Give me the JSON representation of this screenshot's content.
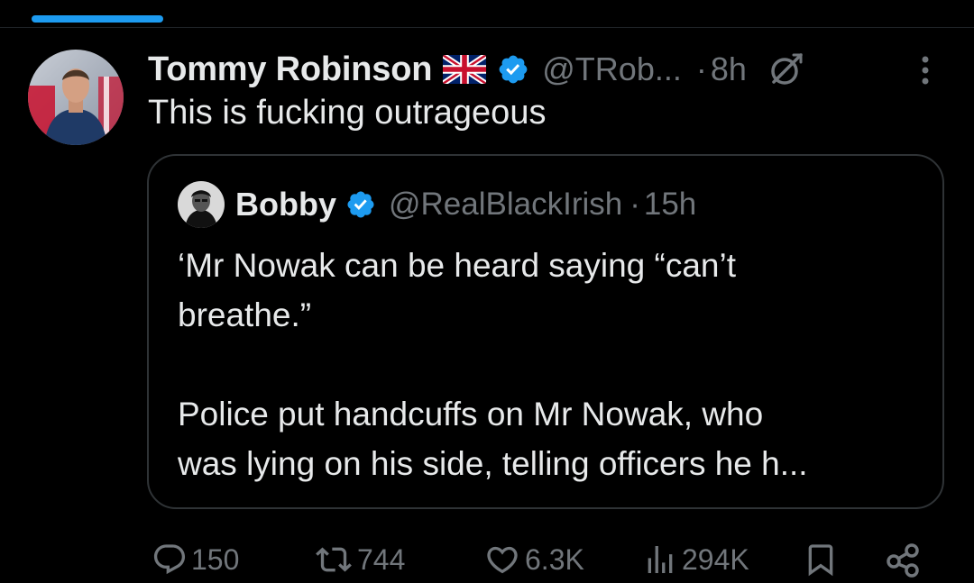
{
  "tweet": {
    "author": {
      "name": "Tommy Robinson",
      "handle": "@TRob...",
      "flag_icon": "union-jack-flag-icon",
      "verified_icon": "verified-badge-icon"
    },
    "separator": "·",
    "time": "8h",
    "text": "This is fucking outrageous",
    "quoted": {
      "author": {
        "name": "Bobby",
        "handle": "@RealBlackIrish",
        "verified_icon": "verified-badge-icon"
      },
      "separator": "·",
      "time": "15h",
      "paragraphs": [
        "‘Mr Nowak can be heard saying “can’t\nbreathe.”",
        "Police put handcuffs on Mr Nowak, who\nwas lying on his side, telling officers he h..."
      ]
    },
    "actions": {
      "replies": "150",
      "reposts": "744",
      "likes": "6.3K",
      "views": "294K"
    }
  },
  "colors": {
    "background": "#000000",
    "text_primary": "#e7e9ea",
    "text_secondary": "#71767b",
    "accent": "#1d9bf0",
    "border": "#2f3336"
  }
}
